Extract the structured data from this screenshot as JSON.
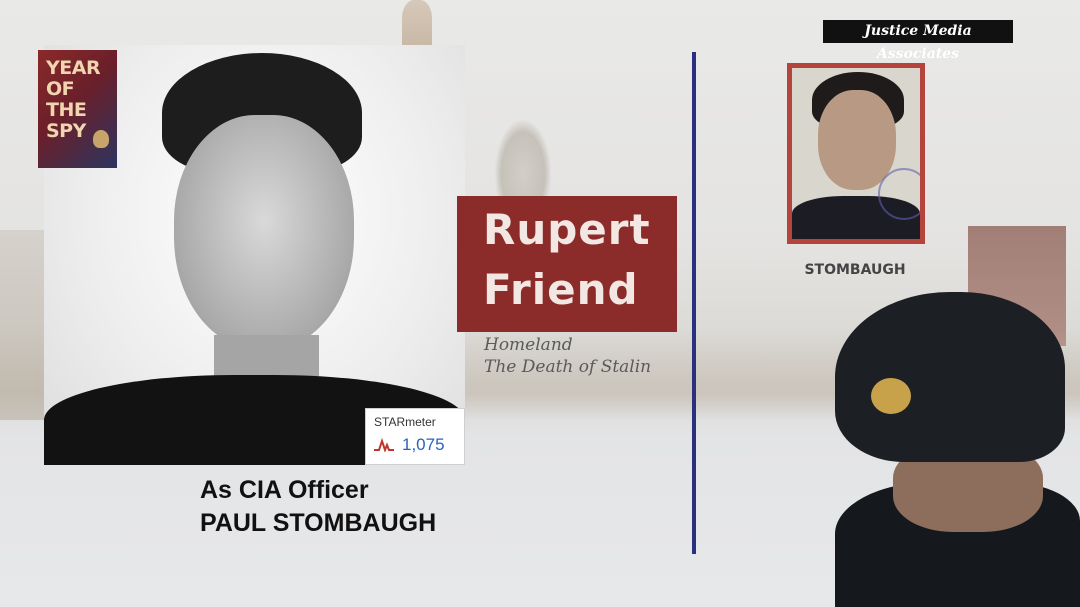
{
  "brand": {
    "name": "Justice Media Associates"
  },
  "logo": {
    "lines": [
      "YEAR",
      "OF",
      "THE",
      "SPY"
    ]
  },
  "actor": {
    "name_line1": "Rupert",
    "name_line2": "Friend",
    "credits": [
      "Homeland",
      "The Death of Stalin"
    ]
  },
  "starmeter": {
    "label": "STARmeter",
    "value": "1,075"
  },
  "caption": {
    "line1": "As CIA Officer",
    "line2": "PAUL STOMBAUGH"
  },
  "passport": {
    "label": "STOMBAUGH"
  },
  "colors": {
    "accent_red": "#8b2c2a",
    "divider_blue": "#2a2f7e",
    "starmeter_blue": "#2b62c0"
  }
}
